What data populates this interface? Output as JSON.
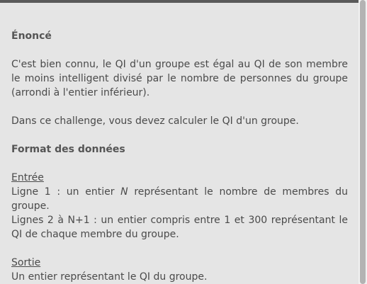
{
  "statement": {
    "title": "Énoncé",
    "paragraph1": "C'est bien connu, le QI d'un groupe est égal au QI de son membre le moins intelligent divisé par le nombre de personnes du groupe (arrondi à l'entier inférieur).",
    "paragraph2": "Dans ce challenge, vous devez calculer le QI d'un groupe."
  },
  "data_format": {
    "title": "Format des données",
    "input": {
      "label": "Entrée",
      "line1_before": "Ligne 1 : un entier ",
      "line1_var": "N",
      "line1_after": " représentant le nombre de membres du groupe.",
      "line2": "Lignes 2 à N+1 : un entier compris entre 1 et 300 représentant le QI de chaque membre du groupe."
    },
    "output": {
      "label": "Sortie",
      "line1": "Un entier représentant le QI du groupe."
    }
  },
  "colors": {
    "background": "#e5e5e5",
    "text": "#4a4a4a",
    "top_bar": "#5a5a5a",
    "scrollbar_thumb": "#b3b3b3"
  }
}
